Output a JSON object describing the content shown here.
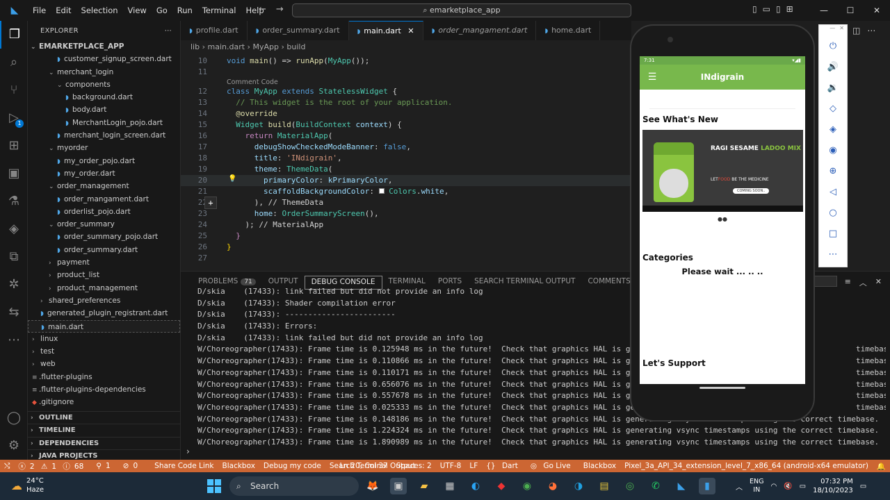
{
  "window": {
    "title": "emarketplace_app",
    "menu": [
      "File",
      "Edit",
      "Selection",
      "View",
      "Go",
      "Run",
      "Terminal",
      "Help"
    ]
  },
  "explorer": {
    "header": "EXPLORER",
    "root": "EMARKETPLACE_APP",
    "rows": [
      {
        "label": "customer_signup_screen.dart",
        "indent": 2,
        "type": "dart"
      },
      {
        "label": "merchant_login",
        "indent": 1,
        "type": "folder-open"
      },
      {
        "label": "components",
        "indent": 2,
        "type": "folder-open"
      },
      {
        "label": "background.dart",
        "indent": 3,
        "type": "dart"
      },
      {
        "label": "body.dart",
        "indent": 3,
        "type": "dart"
      },
      {
        "label": "MerchantLogin_pojo.dart",
        "indent": 3,
        "type": "dart"
      },
      {
        "label": "merchant_login_screen.dart",
        "indent": 2,
        "type": "dart"
      },
      {
        "label": "myorder",
        "indent": 1,
        "type": "folder-open"
      },
      {
        "label": "my_order_pojo.dart",
        "indent": 2,
        "type": "dart"
      },
      {
        "label": "my_order.dart",
        "indent": 2,
        "type": "dart"
      },
      {
        "label": "order_management",
        "indent": 1,
        "type": "folder-open"
      },
      {
        "label": "order_mangament.dart",
        "indent": 2,
        "type": "dart"
      },
      {
        "label": "orderlist_pojo.dart",
        "indent": 2,
        "type": "dart"
      },
      {
        "label": "order_summary",
        "indent": 1,
        "type": "folder-open"
      },
      {
        "label": "order_summary_pojo.dart",
        "indent": 2,
        "type": "dart"
      },
      {
        "label": "order_summary.dart",
        "indent": 2,
        "type": "dart"
      },
      {
        "label": "payment",
        "indent": 1,
        "type": "folder"
      },
      {
        "label": "product_list",
        "indent": 1,
        "type": "folder"
      },
      {
        "label": "product_management",
        "indent": 1,
        "type": "folder"
      },
      {
        "label": "shared_preferences",
        "indent": 0,
        "type": "folder"
      },
      {
        "label": "generated_plugin_registrant.dart",
        "indent": 0,
        "type": "dart"
      },
      {
        "label": "main.dart",
        "indent": 0,
        "type": "dart",
        "selected": true
      },
      {
        "label": "linux",
        "indent": -1,
        "type": "folder"
      },
      {
        "label": "test",
        "indent": -1,
        "type": "folder"
      },
      {
        "label": "web",
        "indent": -1,
        "type": "folder"
      },
      {
        "label": ".flutter-plugins",
        "indent": -1,
        "type": "file"
      },
      {
        "label": ".flutter-plugins-dependencies",
        "indent": -1,
        "type": "file"
      },
      {
        "label": ".gitignore",
        "indent": -1,
        "type": "git"
      }
    ],
    "sections": [
      "OUTLINE",
      "TIMELINE",
      "DEPENDENCIES",
      "JAVA PROJECTS"
    ]
  },
  "tabs": [
    {
      "label": "profile.dart",
      "active": false,
      "italic": false
    },
    {
      "label": "order_summary.dart",
      "active": false,
      "italic": false
    },
    {
      "label": "main.dart",
      "active": true,
      "italic": false
    },
    {
      "label": "order_mangament.dart",
      "active": false,
      "italic": true
    },
    {
      "label": "home.dart",
      "active": false,
      "italic": false
    }
  ],
  "breadcrumb": {
    "parts": [
      "lib",
      "main.dart",
      "MyApp",
      "build"
    ]
  },
  "codelens": "Comment Code",
  "problems_count": "71",
  "panel_tabs": [
    "PROBLEMS",
    "OUTPUT",
    "DEBUG CONSOLE",
    "TERMINAL",
    "PORTS",
    "SEARCH TERMINAL OUTPUT",
    "COMMENTS"
  ],
  "console": [
    "D/skia    (17433): link failed but did not provide an info log",
    "D/skia    (17433): Shader compilation error",
    "D/skia    (17433): ------------------------",
    "D/skia    (17433): Errors:",
    "D/skia    (17433): link failed but did not provide an info log",
    "W/Choreographer(17433): Frame time is 0.125948 ms in the future!  Check that graphics HAL is gene                                              timebase.",
    "W/Choreographer(17433): Frame time is 0.110866 ms in the future!  Check that graphics HAL is gene                                              timebase.",
    "W/Choreographer(17433): Frame time is 0.110171 ms in the future!  Check that graphics HAL is gene                                              timebase.",
    "W/Choreographer(17433): Frame time is 0.656076 ms in the future!  Check that graphics HAL is gene                                              timebase.",
    "W/Choreographer(17433): Frame time is 0.557678 ms in the future!  Check that graphics HAL is gene                                              timebase.",
    "W/Choreographer(17433): Frame time is 0.025333 ms in the future!  Check that graphics HAL is gene                                              timebase.",
    "W/Choreographer(17433): Frame time is 0.148186 ms in the future!  Check that graphics HAL is generating vsync timestamps using the correct timebase.",
    "W/Choreographer(17433): Frame time is 1.224324 ms in the future!  Check that graphics HAL is generating vsync timestamps using the correct timebase.",
    "W/Choreographer(17433): Frame time is 1.890989 ms in the future!  Check that graphics HAL is generating vsync timestamps using the correct timebase."
  ],
  "status": {
    "errors": "2",
    "warnings": "1",
    "infos": "68",
    "ports": "1",
    "zero": "0",
    "items_left": [
      "Share Code Link",
      "Blackbox",
      "Debug my code",
      "Search Terminal Output"
    ],
    "position": "Ln 20, Col 37",
    "spaces": "Spaces: 2",
    "encoding": "UTF-8",
    "eol": "LF",
    "language": "Dart",
    "golive": "Go Live",
    "blackbox": "Blackbox",
    "device": "Pixel_3a_API_34_extension_level_7_x86_64 (android-x64 emulator)"
  },
  "phone": {
    "time": "7:31",
    "app_title": "INdigrain",
    "whats_new": "See What's New",
    "banner_title": "RAGI SESAME",
    "banner_title_accent": "LADOO MIX",
    "banner_tag": "LET",
    "banner_tag_accent": "FOOD",
    "banner_tag_rest": "BE THE MEDICINE",
    "banner_button": "COMING SOON..",
    "categories": "Categories",
    "please_wait": "Please wait ... .. ..",
    "lets_support": "Let's Support"
  },
  "taskbar": {
    "temp": "24°C",
    "weather": "Haze",
    "search": "Search",
    "lang1": "ENG",
    "lang2": "IN",
    "time": "07:32 PM",
    "date": "18/10/2023"
  },
  "colors": {
    "statusbar": "#cc6633",
    "accent": "#0078d4",
    "appbar": "#78b84c"
  }
}
